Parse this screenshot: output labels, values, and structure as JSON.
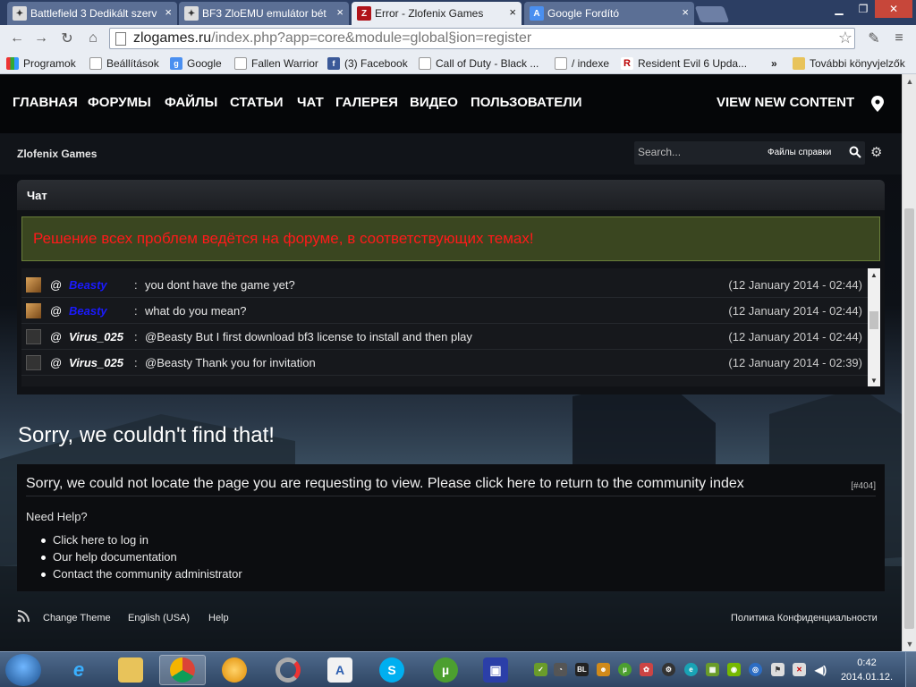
{
  "browser": {
    "tabs": [
      {
        "title": "Battlefield 3 Dedikált szerv",
        "active": false
      },
      {
        "title": "BF3 ZloEMU emulátor bét",
        "active": false
      },
      {
        "title": "Error - Zlofenix Games",
        "active": true
      },
      {
        "title": "Google Fordító",
        "active": false
      }
    ],
    "url_host": "zlogames.ru",
    "url_path": "/index.php?app=core&module=global§ion=register",
    "bookmarks": [
      "Programok",
      "Beállítások",
      "Google",
      "Fallen Warrior",
      "(3) Facebook",
      "Call of Duty - Black ...",
      "/ indexe",
      "Resident Evil 6 Upda...",
      "»",
      "További könyvjelzők"
    ]
  },
  "site": {
    "nav": [
      "ГЛАВНАЯ",
      "ФОРУМЫ",
      "ФАЙЛЫ",
      "СТАТЬИ",
      "ЧАТ",
      "ГАЛЕРЕЯ",
      "ВИДЕО",
      "ПОЛЬЗОВАТЕЛИ"
    ],
    "view_new_content": "VIEW NEW CONTENT",
    "brand": "Zlofenix Games",
    "search_placeholder": "Search...",
    "search_scope": "Файлы справки"
  },
  "chat": {
    "title": "Чат",
    "notice": "Решение всех проблем ведётся на форуме, в соответствующих темах!",
    "messages": [
      {
        "at": "@",
        "user": "Beasty",
        "user_color": "#1a1aff",
        "text": "you dont have the game yet?",
        "time": "(12 January 2014 - 02:44)"
      },
      {
        "at": "@",
        "user": "Beasty",
        "user_color": "#1a1aff",
        "text": "what do you mean?",
        "time": "(12 January 2014 - 02:44)"
      },
      {
        "at": "@",
        "user": "Virus_025",
        "user_color": "#ffffff",
        "text": "@Beasty But I first download bf3 license to install and then play",
        "time": "(12 January 2014 - 02:44)"
      },
      {
        "at": "@",
        "user": "Virus_025",
        "user_color": "#ffffff",
        "text": "@Beasty Thank you for invitation",
        "time": "(12 January 2014 - 02:39)"
      }
    ]
  },
  "error": {
    "title": "Sorry, we couldn't find that!",
    "message": "Sorry, we could not locate the page you are requesting to view. Please click here to return to the community index",
    "code": "[#404]",
    "help_heading": "Need Help?",
    "help_links": [
      "Click here to log in",
      "Our help documentation",
      "Contact the community administrator"
    ]
  },
  "footer": {
    "change_theme": "Change Theme",
    "language": "English (USA)",
    "help": "Help",
    "privacy": "Политика Конфиденциальности"
  },
  "taskbar": {
    "time": "0:42",
    "date": "2014.01.12."
  },
  "colors": {
    "notice_text": "#ff1a1a",
    "notice_bg": "#3a4620",
    "mod_user": "#1a1aff"
  }
}
